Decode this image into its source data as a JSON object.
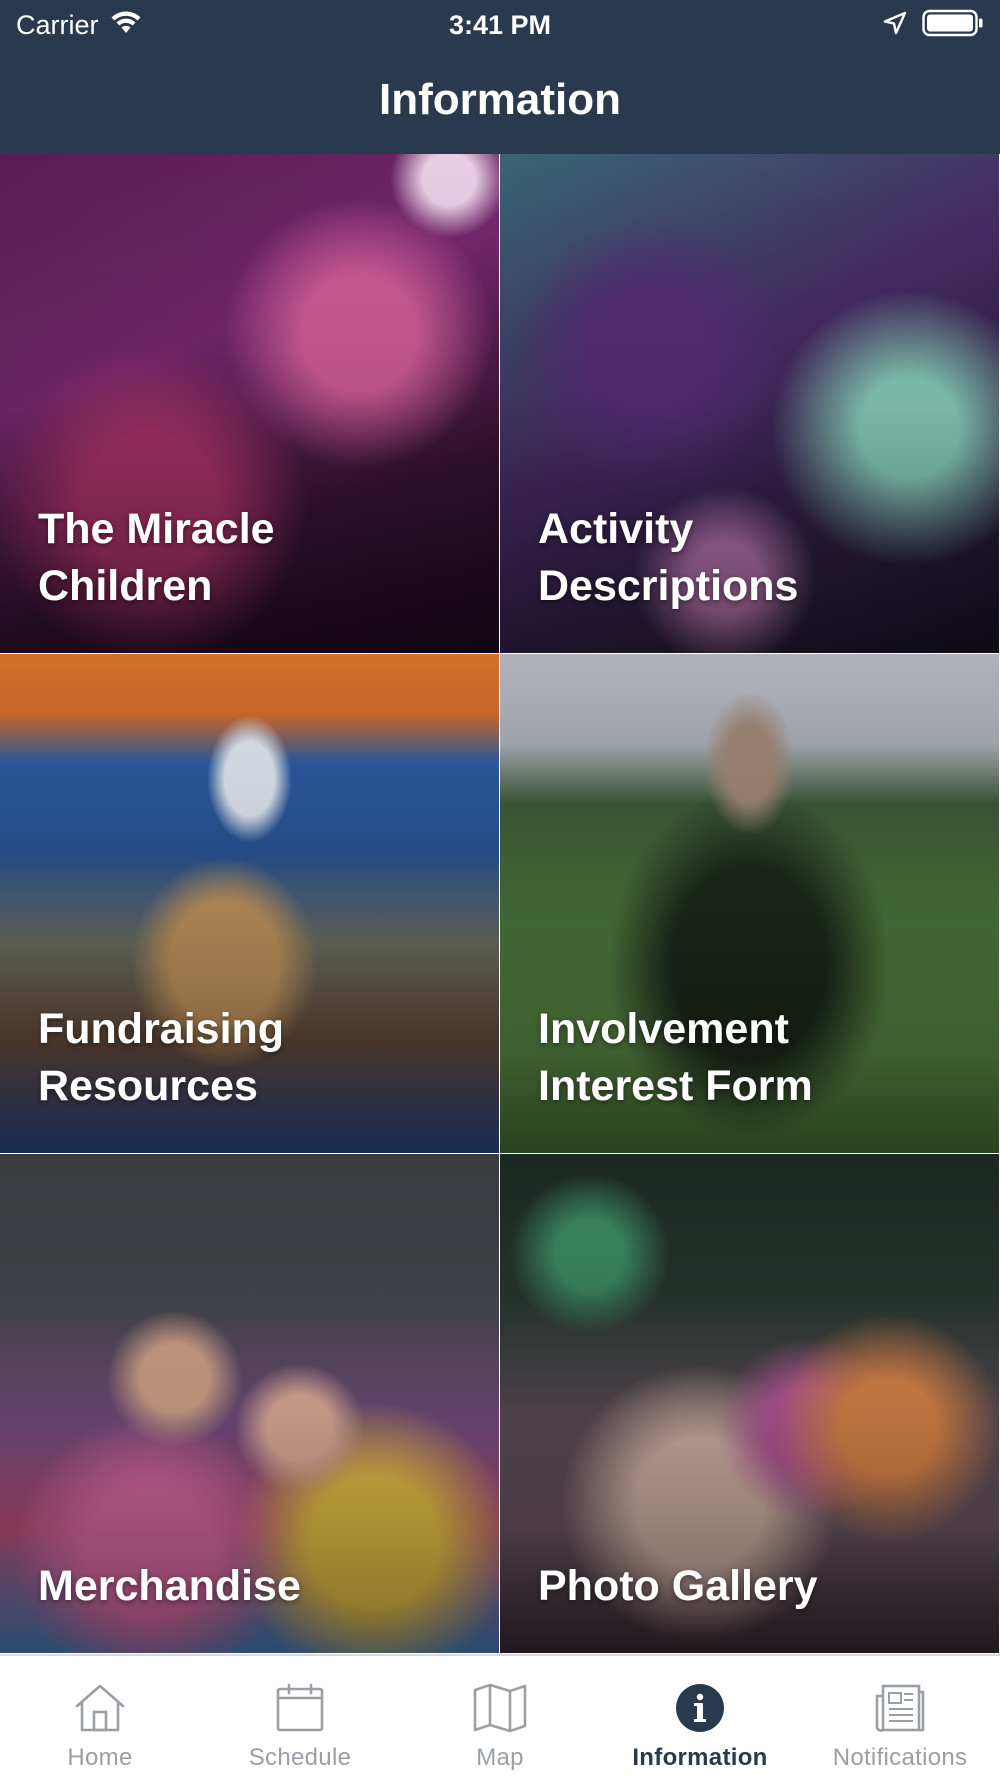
{
  "status_bar": {
    "carrier": "Carrier",
    "time": "3:41 PM"
  },
  "header": {
    "title": "Information"
  },
  "colors": {
    "header_bg": "#293a4f",
    "tab_active": "#293a4f",
    "tab_inactive": "#9a9fa6"
  },
  "tiles": [
    {
      "label": "The Miracle Children",
      "line1": "The Miracle",
      "line2": "Children",
      "photo": "photo-kids-at-event"
    },
    {
      "label": "Activity Descriptions",
      "line1": "Activity",
      "line2": "Descriptions",
      "photo": "photo-dancers-high-five"
    },
    {
      "label": "Fundraising Resources",
      "line1": "Fundraising",
      "line2": "Resources",
      "photo": "photo-puppy-ftk-sign"
    },
    {
      "label": "Involvement Interest Form",
      "line1": "Involvement",
      "line2": "Interest Form",
      "photo": "photo-ftk-letters-on-grass"
    },
    {
      "label": "Merchandise",
      "line1": "Merchandise",
      "line2": "",
      "photo": "photo-group-tie-dye"
    },
    {
      "label": "Photo Gallery",
      "line1": "Photo Gallery",
      "line2": "",
      "photo": "photo-crowd-dancing"
    }
  ],
  "tabbar": {
    "items": [
      {
        "label": "Home",
        "icon": "home-icon",
        "active": false
      },
      {
        "label": "Schedule",
        "icon": "calendar-icon",
        "active": false
      },
      {
        "label": "Map",
        "icon": "map-icon",
        "active": false
      },
      {
        "label": "Information",
        "icon": "info-icon",
        "active": true
      },
      {
        "label": "Notifications",
        "icon": "newspaper-icon",
        "active": false
      }
    ]
  }
}
